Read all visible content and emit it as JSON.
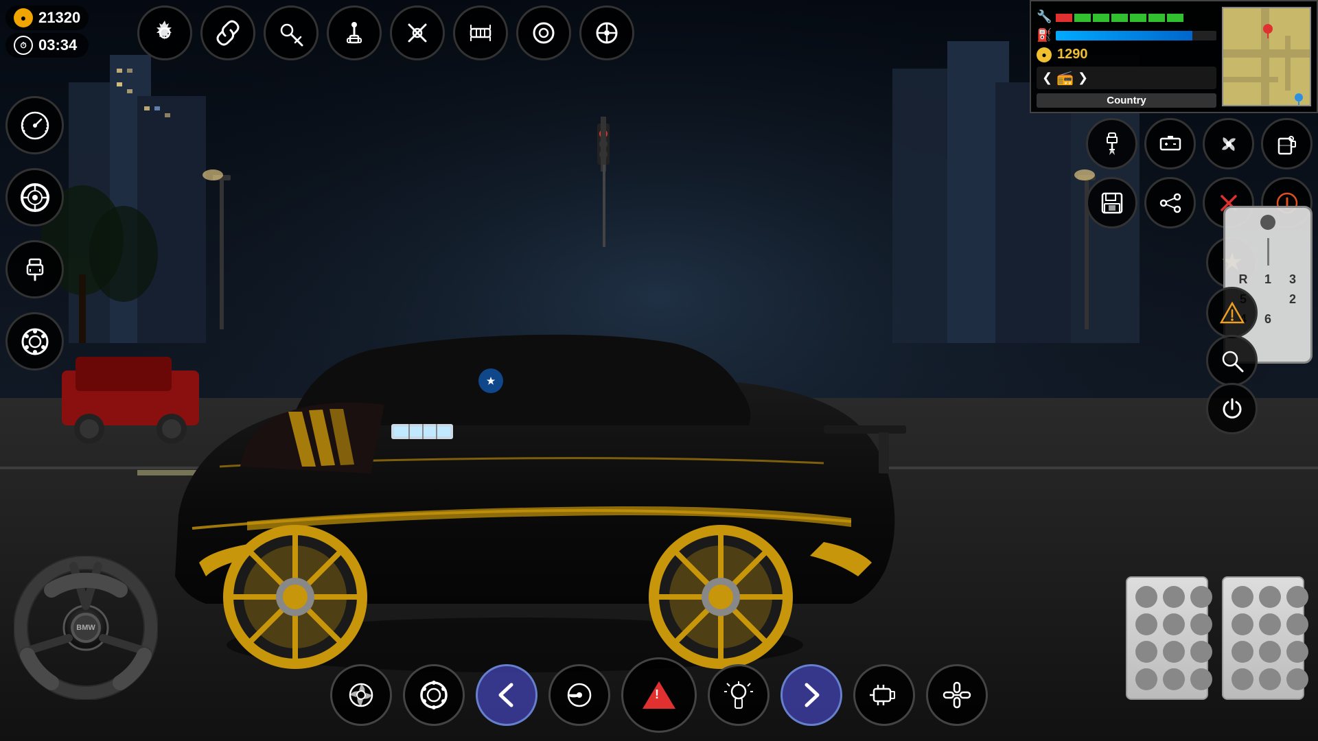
{
  "hud": {
    "coins": "21320",
    "timer": "03:34",
    "fuel_amount": "1290",
    "map_label": "Country",
    "fuel_percent": 85
  },
  "top_toolbar": {
    "buttons": [
      {
        "id": "settings",
        "icon": "⚙",
        "label": "Settings"
      },
      {
        "id": "link",
        "icon": "🔗",
        "label": "Link"
      },
      {
        "id": "key",
        "icon": "🔑",
        "label": "Key"
      },
      {
        "id": "joystick",
        "icon": "🕹",
        "label": "Joystick"
      },
      {
        "id": "wrench-cross",
        "icon": "🔧",
        "label": "Repair"
      },
      {
        "id": "gearbox",
        "icon": "⚙",
        "label": "Gearbox"
      },
      {
        "id": "ring",
        "icon": "⭕",
        "label": "Ring"
      },
      {
        "id": "wheel",
        "icon": "⚙",
        "label": "Wheel"
      }
    ]
  },
  "left_sidebar": {
    "buttons": [
      {
        "id": "speedometer",
        "icon": "⊙",
        "label": "Speedometer"
      },
      {
        "id": "tire",
        "icon": "⊙",
        "label": "Tire"
      },
      {
        "id": "plug",
        "icon": "⚡",
        "label": "Plug"
      },
      {
        "id": "brake",
        "icon": "⊙",
        "label": "Brake"
      }
    ]
  },
  "right_panel": {
    "row1": [
      {
        "id": "spark-plug",
        "icon": "🔌",
        "label": "Spark Plug"
      },
      {
        "id": "battery",
        "icon": "🔋",
        "label": "Battery"
      },
      {
        "id": "fan",
        "icon": "💨",
        "label": "Fan"
      },
      {
        "id": "fuel-tank",
        "icon": "⛽",
        "label": "Fuel Tank"
      }
    ],
    "row2": [
      {
        "id": "save",
        "icon": "💾",
        "label": "Save"
      },
      {
        "id": "share",
        "icon": "📤",
        "label": "Share"
      },
      {
        "id": "close",
        "icon": "✕",
        "label": "Close"
      },
      {
        "id": "alert",
        "icon": "!",
        "label": "Alert"
      }
    ],
    "row3_single": [
      {
        "id": "star",
        "icon": "★",
        "label": "Favorite"
      }
    ],
    "row4": [
      {
        "id": "warning",
        "icon": "⚠",
        "label": "Warning"
      }
    ],
    "row5": [
      {
        "id": "search",
        "icon": "🔍",
        "label": "Search"
      }
    ],
    "row6": [
      {
        "id": "power",
        "icon": "⏻",
        "label": "Power"
      }
    ]
  },
  "gear_labels": [
    "R",
    "1",
    "3",
    "5",
    "",
    "2",
    "4",
    "6"
  ],
  "bottom_toolbar": {
    "buttons": [
      {
        "id": "turbo",
        "icon": "⊙",
        "label": "Turbo"
      },
      {
        "id": "brake-disc",
        "icon": "⊙",
        "label": "Brake Disc"
      },
      {
        "id": "arrow-left",
        "icon": "←",
        "label": "Turn Left"
      },
      {
        "id": "wiper",
        "icon": "⊙",
        "label": "Wiper"
      },
      {
        "id": "hazard",
        "icon": "△",
        "label": "Hazard"
      },
      {
        "id": "light",
        "icon": "⊙",
        "label": "Light"
      },
      {
        "id": "arrow-right",
        "icon": "→",
        "label": "Turn Right"
      },
      {
        "id": "engine",
        "icon": "⊙",
        "label": "Engine"
      },
      {
        "id": "chain",
        "icon": "⊙",
        "label": "Chain"
      }
    ]
  }
}
